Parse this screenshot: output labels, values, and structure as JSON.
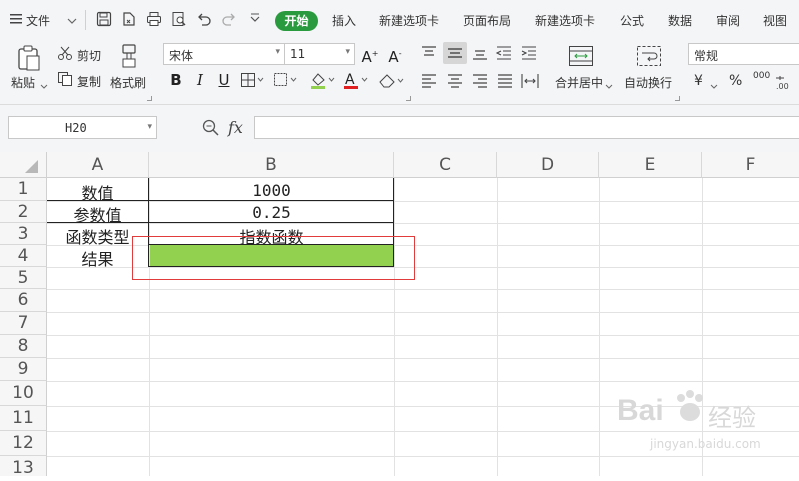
{
  "menubar": {
    "file_label": "文件",
    "tabs": {
      "start": "开始",
      "insert": "插入",
      "new_tab1": "新建选项卡",
      "page_layout": "页面布局",
      "new_tab2": "新建选项卡",
      "formula": "公式",
      "data": "数据",
      "review": "审阅",
      "view": "视图"
    }
  },
  "ribbon": {
    "paste": "粘贴",
    "cut": "剪切",
    "copy": "复制",
    "format_painter": "格式刷",
    "font_name": "宋体",
    "font_size": "11",
    "merge_center": "合并居中",
    "wrap_text": "自动换行",
    "number_format": "常规",
    "currency": "¥",
    "percent": "%",
    "thousands": "000"
  },
  "formula_bar": {
    "name_box": "H20",
    "fx": "fx",
    "value": ""
  },
  "columns": [
    "A",
    "B",
    "C",
    "D",
    "E",
    "F"
  ],
  "rows": [
    "1",
    "2",
    "3",
    "4",
    "5",
    "6",
    "7",
    "8",
    "9",
    "10",
    "11",
    "12",
    "13"
  ],
  "cells": {
    "A1": "数值",
    "B1": "1000",
    "A2": "参数值",
    "B2": "0.25",
    "A3": "函数类型",
    "B3": "指数函数",
    "A4": "结果",
    "B4": ""
  },
  "colors": {
    "accent_green": "#2a9a3e",
    "result_fill": "#92d050",
    "annotation_red": "#e23b3b"
  },
  "watermark": {
    "brand": "Bai",
    "brand2": "经验",
    "url": "jingyan.baidu.com"
  }
}
